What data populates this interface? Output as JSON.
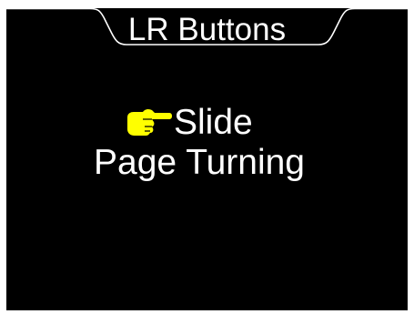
{
  "header": {
    "title": "LR Buttons"
  },
  "menu": {
    "items": [
      {
        "label": "Slide",
        "selected": true,
        "icon": "pointing-hand-icon"
      },
      {
        "label": "Page Turning",
        "selected": false
      }
    ]
  },
  "colors": {
    "background": "#000000",
    "text": "#ffffff",
    "pointer": "#ffff00",
    "outer": "#ffffff"
  }
}
